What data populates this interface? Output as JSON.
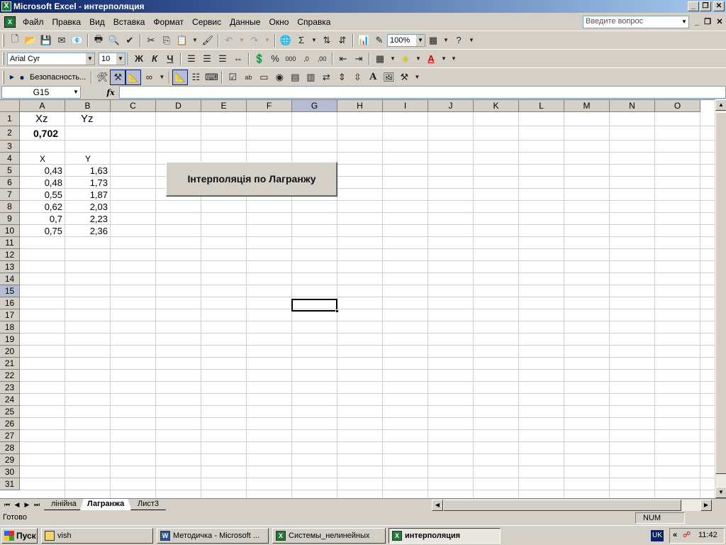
{
  "window": {
    "title": "Microsoft Excel - интерполяция",
    "minimize": "_",
    "restore": "❐",
    "close": "✕"
  },
  "menu": {
    "items": [
      "Файл",
      "Правка",
      "Вид",
      "Вставка",
      "Формат",
      "Сервис",
      "Данные",
      "Окно",
      "Справка"
    ],
    "ask_placeholder": "Введите вопрос"
  },
  "toolbar_standard": {
    "zoom": "100%"
  },
  "toolbar_format": {
    "font": "Arial Cyr",
    "size": "10",
    "bold": "Ж",
    "italic": "К",
    "underline": "Ч"
  },
  "toolbar_control": {
    "security_label": "Безопасность..."
  },
  "formula_bar": {
    "name_box": "G15",
    "fx": "fx",
    "formula": ""
  },
  "grid": {
    "columns": [
      "A",
      "B",
      "C",
      "D",
      "E",
      "F",
      "G",
      "H",
      "I",
      "J",
      "K",
      "L",
      "M",
      "N",
      "O"
    ],
    "rows": [
      "1",
      "2",
      "3",
      "4",
      "5",
      "6",
      "7",
      "8",
      "9",
      "10",
      "11",
      "12",
      "13",
      "14",
      "15",
      "16",
      "17",
      "18",
      "19",
      "20",
      "21",
      "22",
      "23",
      "24",
      "25",
      "26",
      "27",
      "28",
      "29",
      "30",
      "31"
    ],
    "selected_column": "G",
    "selected_row": "15",
    "header_xz": "Xz",
    "header_yz": "Yz",
    "xz_value": "0,702",
    "label_x": "X",
    "label_y": "Y",
    "x_values": [
      "0,43",
      "0,48",
      "0,55",
      "0,62",
      "0,7",
      "0,75"
    ],
    "y_values": [
      "1,63",
      "1,73",
      "1,87",
      "2,03",
      "2,23",
      "2,36"
    ]
  },
  "macro_button": {
    "label": "Інтерполяція  по Лагранжу"
  },
  "sheet_tabs": [
    "лінійна",
    "Лагранжа",
    "Лист3"
  ],
  "active_sheet": "Лагранжа",
  "status": {
    "text": "Готово",
    "num": "NUM"
  },
  "taskbar": {
    "start": "Пуск",
    "tasks": [
      "vish",
      "Методичка - Microsoft ...",
      "Системы_нелинейных",
      "интерполяция"
    ],
    "lang": "UK",
    "clock": "11:42"
  }
}
